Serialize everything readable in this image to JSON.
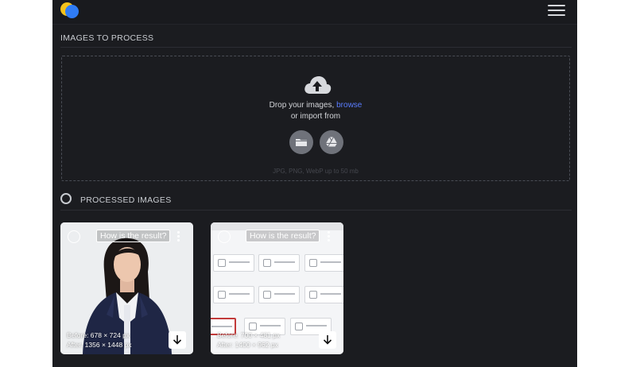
{
  "header": {
    "logo_icon": "app-logo-icon",
    "menu_icon": "hamburger-menu-icon"
  },
  "images_to_process": {
    "title": "IMAGES TO PROCESS"
  },
  "dropzone": {
    "upload_icon": "cloud-upload-icon",
    "drop_text": "Drop your images,",
    "browse_label": "browse",
    "import_text": "or import from",
    "sources": [
      {
        "name": "local-folder",
        "icon": "folder-icon"
      },
      {
        "name": "google-drive",
        "icon": "google-drive-icon"
      }
    ],
    "hint": "JPG, PNG, WebP up to 50 mb"
  },
  "processed_images": {
    "title": "PROCESSED IMAGES"
  },
  "cards": [
    {
      "feedback_label": "How is the result?",
      "before": "Before: 678 × 724 px",
      "after": "After: 1356 × 1448 px"
    },
    {
      "feedback_label": "How is the result?",
      "before": "Before: 700 × 481 px",
      "after": "After: 1400 × 962 px"
    }
  ],
  "colors": {
    "background": "#1b1c20",
    "accent_link": "#5a7dff",
    "icon_button": "#6f727a"
  }
}
